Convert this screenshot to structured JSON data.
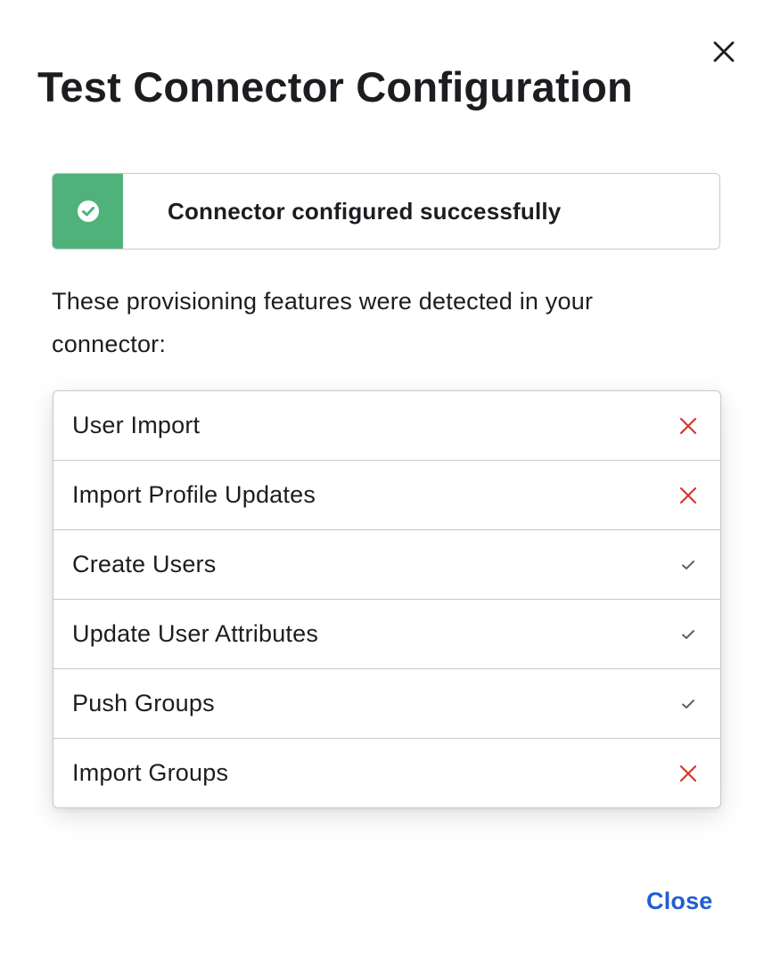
{
  "dialog": {
    "title": "Test Connector Configuration",
    "close_icon": "close-icon"
  },
  "banner": {
    "icon": "check-circle-icon",
    "message": "Connector configured successfully",
    "accent_color": "#4fb27a"
  },
  "description": "These provisioning features were detected in your connector:",
  "features": [
    {
      "label": "User Import",
      "detected": false,
      "icon": "x-icon"
    },
    {
      "label": "Import Profile Updates",
      "detected": false,
      "icon": "x-icon"
    },
    {
      "label": "Create Users",
      "detected": true,
      "icon": "check-icon"
    },
    {
      "label": "Update User Attributes",
      "detected": true,
      "icon": "check-icon"
    },
    {
      "label": "Push Groups",
      "detected": true,
      "icon": "check-icon"
    },
    {
      "label": "Import Groups",
      "detected": false,
      "icon": "x-icon"
    }
  ],
  "colors": {
    "error": "#d4382c",
    "check": "#5f5f66",
    "link": "#1f5fd1"
  },
  "footer": {
    "close_label": "Close"
  }
}
